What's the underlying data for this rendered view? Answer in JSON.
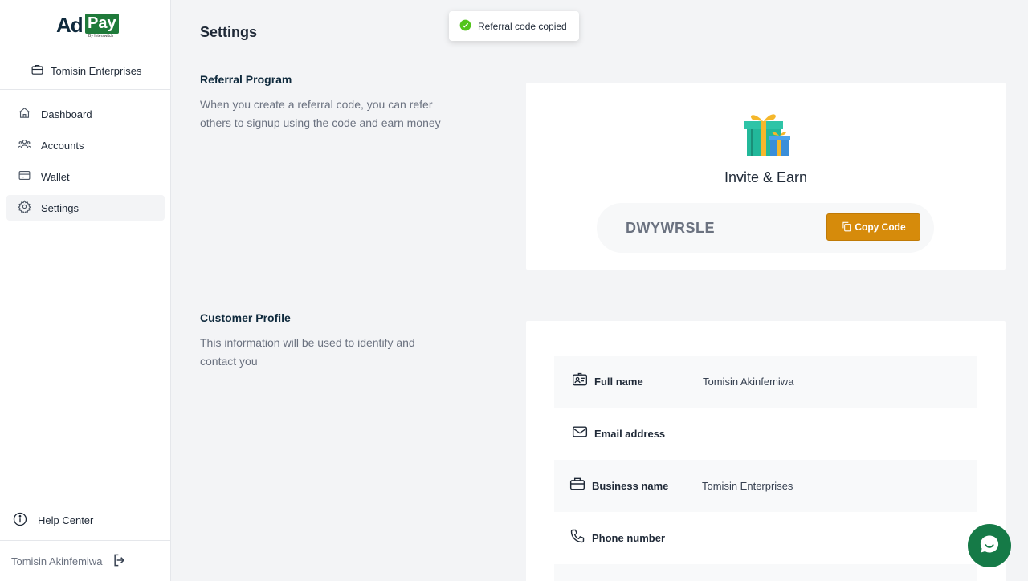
{
  "brand": {
    "logo_ad": "Ad",
    "logo_pay": "Pay",
    "logo_by": "By Interswitch"
  },
  "sidebar": {
    "business_name": "Tomisin Enterprises",
    "items": [
      {
        "label": "Dashboard",
        "icon": "home-icon"
      },
      {
        "label": "Accounts",
        "icon": "users-icon"
      },
      {
        "label": "Wallet",
        "icon": "wallet-icon"
      },
      {
        "label": "Settings",
        "icon": "gear-icon",
        "active": true
      }
    ],
    "help_label": "Help Center",
    "user_name": "Tomisin Akinfemiwa"
  },
  "page": {
    "title": "Settings"
  },
  "toast": {
    "message": "Referral code copied",
    "status_color": "#52c41a"
  },
  "referral": {
    "title": "Referral Program",
    "description": "When you create a referral code, you can refer others to signup using the code and earn money",
    "heading": "Invite & Earn",
    "code": "DWYWRSLE",
    "copy_label": "Copy Code",
    "button_color": "#d68b0b"
  },
  "profile": {
    "title": "Customer Profile",
    "description": "This information will be used to identify and contact you",
    "rows": [
      {
        "label": "Full name",
        "value": "Tomisin Akinfemiwa",
        "icon": "id-card-icon"
      },
      {
        "label": "Email address",
        "value": "",
        "icon": "mail-icon"
      },
      {
        "label": "Business name",
        "value": "Tomisin Enterprises",
        "icon": "briefcase-icon"
      },
      {
        "label": "Phone number",
        "value": "",
        "icon": "phone-icon"
      }
    ]
  },
  "colors": {
    "chat_bubble": "#157a47"
  }
}
